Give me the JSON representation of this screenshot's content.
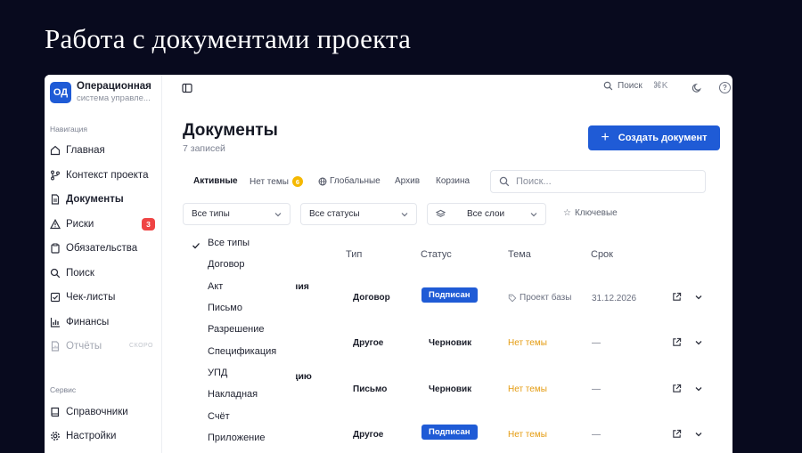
{
  "slide_title": "Работа с документами проекта",
  "app": {
    "logo_text": "ОД",
    "name": "Операционная",
    "subtitle": "система управле..."
  },
  "sidebar": {
    "nav_section": "Навигация",
    "items": [
      {
        "label": "Главная",
        "icon": "home-icon"
      },
      {
        "label": "Контекст проекта",
        "icon": "branch-icon"
      },
      {
        "label": "Документы",
        "icon": "document-icon"
      },
      {
        "label": "Риски",
        "icon": "warning-icon",
        "badge": "3"
      },
      {
        "label": "Обязательства",
        "icon": "clipboard-icon"
      },
      {
        "label": "Поиск",
        "icon": "search-icon"
      },
      {
        "label": "Чек-листы",
        "icon": "checklist-icon"
      },
      {
        "label": "Финансы",
        "icon": "bar-chart-icon"
      },
      {
        "label": "Отчёты",
        "icon": "report-icon",
        "tag": "СКОРО",
        "disabled": true
      }
    ],
    "service_section": "Сервис",
    "service_items": [
      {
        "label": "Справочники",
        "icon": "book-icon"
      },
      {
        "label": "Настройки",
        "icon": "gear-icon"
      }
    ]
  },
  "topbar": {
    "search_label": "Поиск",
    "shortcut": "⌘K"
  },
  "page": {
    "title": "Документы",
    "count": "7 записей",
    "create_label": "Создать документ"
  },
  "tabs": {
    "active": "Активные",
    "no_theme": "Нет темы",
    "no_theme_badge": "6",
    "global": "Глобальные",
    "archive": "Архив",
    "trash": "Корзина"
  },
  "search": {
    "placeholder": "Поиск..."
  },
  "filters": {
    "types": "Все типы",
    "statuses": "Все статусы",
    "layers": "Все слои",
    "key": "Ключевые"
  },
  "table": {
    "headers": {
      "type": "Тип",
      "status": "Статус",
      "theme": "Тема",
      "deadline": "Срок"
    },
    "rows": [
      {
        "name_fragment": "ния",
        "type": "Договор",
        "status": "Подписан",
        "status_kind": "signed",
        "theme": "Проект базы",
        "theme_kind": "tag",
        "deadline": "31.12.2026"
      },
      {
        "name_fragment": "",
        "type": "Другое",
        "status": "Черновик",
        "status_kind": "draft",
        "theme": "Нет темы",
        "theme_kind": "none",
        "deadline": "—"
      },
      {
        "name_fragment": "цию",
        "type": "Письмо",
        "status": "Черновик",
        "status_kind": "draft",
        "theme": "Нет темы",
        "theme_kind": "none",
        "deadline": "—"
      },
      {
        "name_fragment": "",
        "type": "Другое",
        "status": "Подписан",
        "status_kind": "signed",
        "theme": "Нет темы",
        "theme_kind": "none",
        "deadline": "—"
      }
    ]
  },
  "type_dropdown": {
    "selected": "Все типы",
    "options": [
      "Все типы",
      "Договор",
      "Акт",
      "Письмо",
      "Разрешение",
      "Спецификация",
      "УПД",
      "Накладная",
      "Счёт",
      "Приложение"
    ]
  },
  "colors": {
    "accent": "#1f5bd6",
    "danger": "#ef4444",
    "warning": "#e49b0f",
    "badge": "#f5b800",
    "slide_bg": "#080a1e"
  }
}
